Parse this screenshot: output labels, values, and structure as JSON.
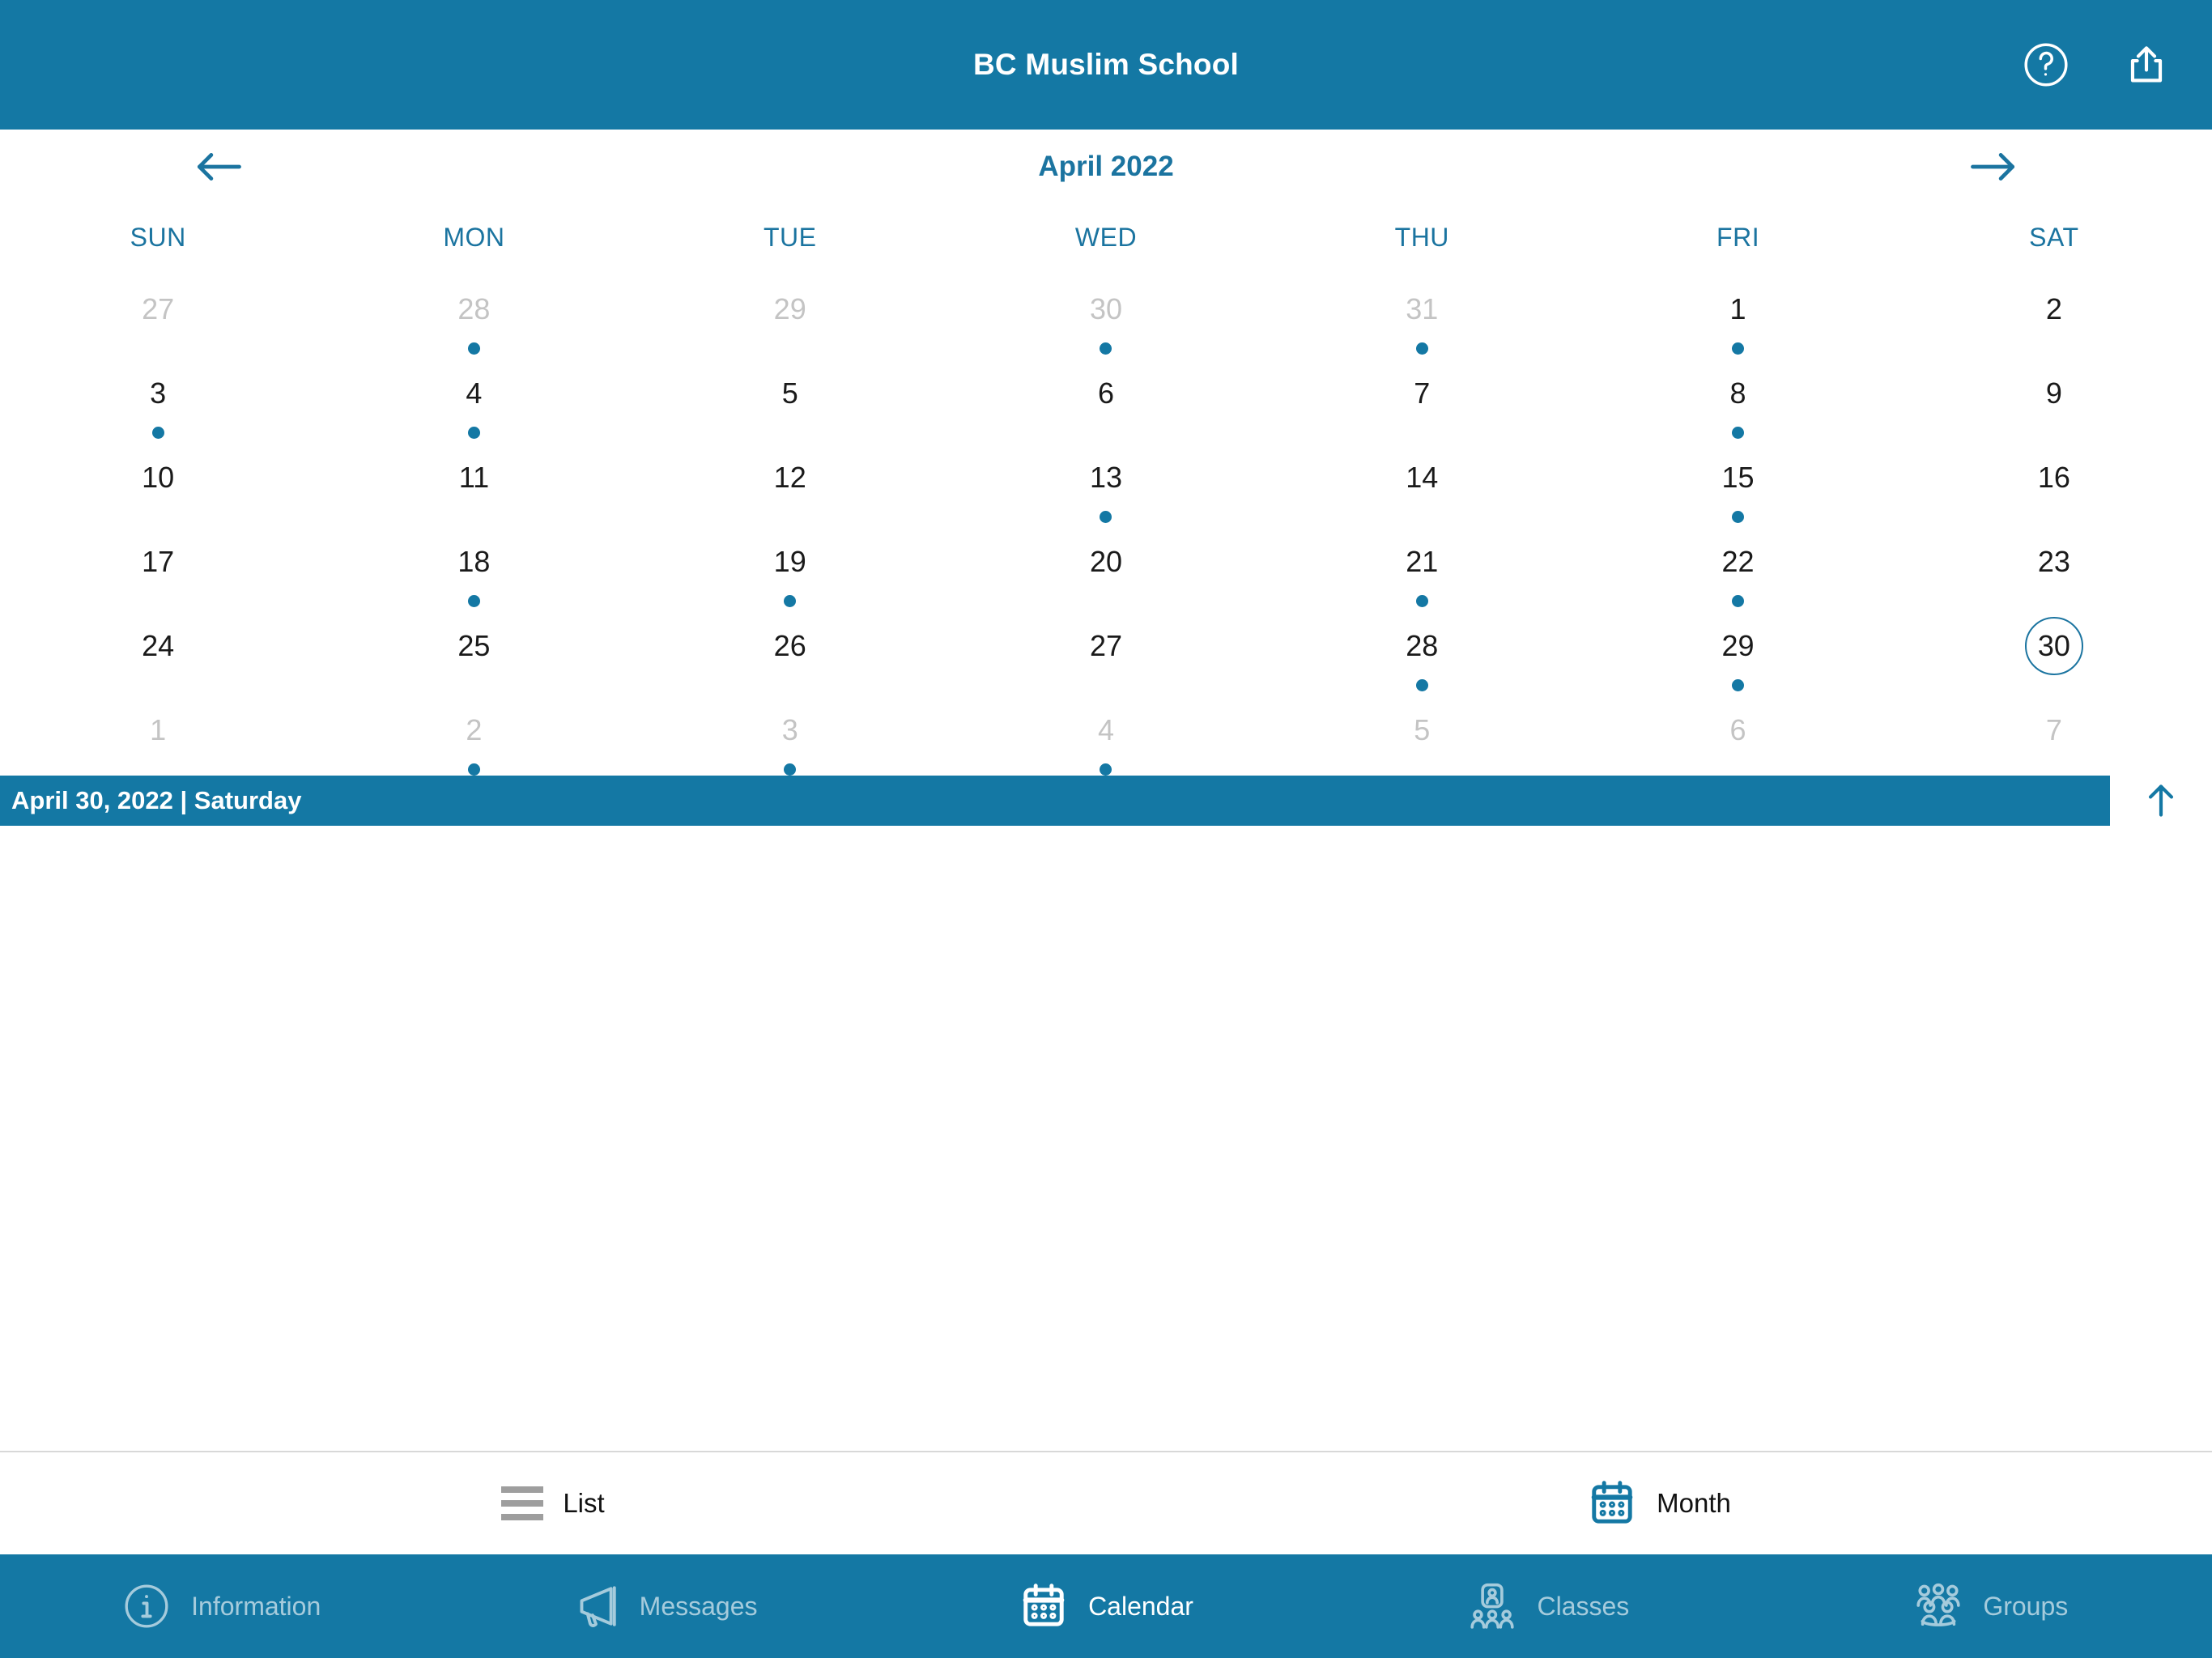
{
  "header": {
    "title": "BC Muslim School",
    "help_icon": "help-circle-icon",
    "share_icon": "share-icon"
  },
  "calendar": {
    "month_label": "April 2022",
    "prev_icon": "arrow-left-icon",
    "next_icon": "arrow-right-icon",
    "weekdays": [
      "SUN",
      "MON",
      "TUE",
      "WED",
      "THU",
      "FRI",
      "SAT"
    ],
    "weeks": [
      [
        {
          "day": "27",
          "muted": true,
          "dot": false,
          "selected": false
        },
        {
          "day": "28",
          "muted": true,
          "dot": true,
          "selected": false
        },
        {
          "day": "29",
          "muted": true,
          "dot": false,
          "selected": false
        },
        {
          "day": "30",
          "muted": true,
          "dot": true,
          "selected": false
        },
        {
          "day": "31",
          "muted": true,
          "dot": true,
          "selected": false
        },
        {
          "day": "1",
          "muted": false,
          "dot": true,
          "selected": false
        },
        {
          "day": "2",
          "muted": false,
          "dot": false,
          "selected": false
        }
      ],
      [
        {
          "day": "3",
          "muted": false,
          "dot": true,
          "selected": false
        },
        {
          "day": "4",
          "muted": false,
          "dot": true,
          "selected": false
        },
        {
          "day": "5",
          "muted": false,
          "dot": false,
          "selected": false
        },
        {
          "day": "6",
          "muted": false,
          "dot": false,
          "selected": false
        },
        {
          "day": "7",
          "muted": false,
          "dot": false,
          "selected": false
        },
        {
          "day": "8",
          "muted": false,
          "dot": true,
          "selected": false
        },
        {
          "day": "9",
          "muted": false,
          "dot": false,
          "selected": false
        }
      ],
      [
        {
          "day": "10",
          "muted": false,
          "dot": false,
          "selected": false
        },
        {
          "day": "11",
          "muted": false,
          "dot": false,
          "selected": false
        },
        {
          "day": "12",
          "muted": false,
          "dot": false,
          "selected": false
        },
        {
          "day": "13",
          "muted": false,
          "dot": true,
          "selected": false
        },
        {
          "day": "14",
          "muted": false,
          "dot": false,
          "selected": false
        },
        {
          "day": "15",
          "muted": false,
          "dot": true,
          "selected": false
        },
        {
          "day": "16",
          "muted": false,
          "dot": false,
          "selected": false
        }
      ],
      [
        {
          "day": "17",
          "muted": false,
          "dot": false,
          "selected": false
        },
        {
          "day": "18",
          "muted": false,
          "dot": true,
          "selected": false
        },
        {
          "day": "19",
          "muted": false,
          "dot": true,
          "selected": false
        },
        {
          "day": "20",
          "muted": false,
          "dot": false,
          "selected": false
        },
        {
          "day": "21",
          "muted": false,
          "dot": true,
          "selected": false
        },
        {
          "day": "22",
          "muted": false,
          "dot": true,
          "selected": false
        },
        {
          "day": "23",
          "muted": false,
          "dot": false,
          "selected": false
        }
      ],
      [
        {
          "day": "24",
          "muted": false,
          "dot": false,
          "selected": false
        },
        {
          "day": "25",
          "muted": false,
          "dot": false,
          "selected": false
        },
        {
          "day": "26",
          "muted": false,
          "dot": false,
          "selected": false
        },
        {
          "day": "27",
          "muted": false,
          "dot": false,
          "selected": false
        },
        {
          "day": "28",
          "muted": false,
          "dot": true,
          "selected": false
        },
        {
          "day": "29",
          "muted": false,
          "dot": true,
          "selected": false
        },
        {
          "day": "30",
          "muted": false,
          "dot": false,
          "selected": true
        }
      ],
      [
        {
          "day": "1",
          "muted": true,
          "dot": false,
          "selected": false
        },
        {
          "day": "2",
          "muted": true,
          "dot": true,
          "selected": false
        },
        {
          "day": "3",
          "muted": true,
          "dot": true,
          "selected": false
        },
        {
          "day": "4",
          "muted": true,
          "dot": true,
          "selected": false
        },
        {
          "day": "5",
          "muted": true,
          "dot": false,
          "selected": false
        },
        {
          "day": "6",
          "muted": true,
          "dot": false,
          "selected": false
        },
        {
          "day": "7",
          "muted": true,
          "dot": false,
          "selected": false
        }
      ]
    ]
  },
  "selected_date_bar": {
    "text": "April 30, 2022 | Saturday",
    "collapse_icon": "arrow-up-icon"
  },
  "view_switcher": {
    "items": [
      {
        "label": "List",
        "icon": "list-icon",
        "active": false
      },
      {
        "label": "Month",
        "icon": "calendar-month-icon",
        "active": true
      }
    ]
  },
  "tabbar": {
    "items": [
      {
        "label": "Information",
        "icon": "info-circle-icon",
        "active": false
      },
      {
        "label": "Messages",
        "icon": "megaphone-icon",
        "active": false
      },
      {
        "label": "Calendar",
        "icon": "calendar-icon",
        "active": true
      },
      {
        "label": "Classes",
        "icon": "classes-icon",
        "active": false
      },
      {
        "label": "Groups",
        "icon": "groups-icon",
        "active": false
      }
    ]
  },
  "colors": {
    "brand_blue": "#1478A4",
    "accent_blue": "#1b74a0",
    "muted_gray": "#c4c4c4",
    "list_icon_gray": "#9e9e9e"
  }
}
